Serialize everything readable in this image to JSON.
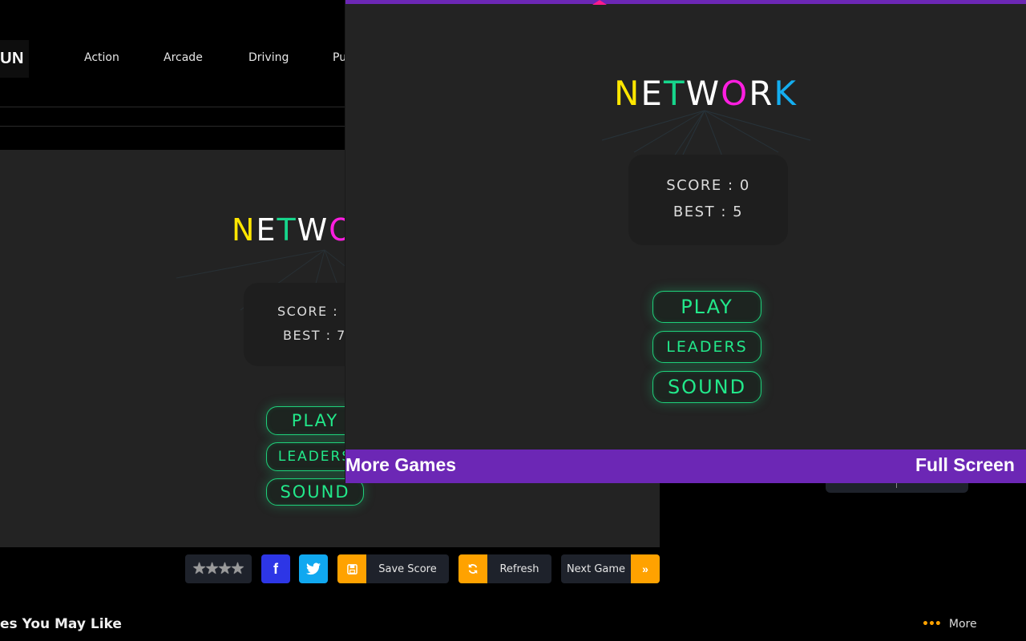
{
  "site": {
    "logo_text": "FUN",
    "nav": [
      "Action",
      "Arcade",
      "Driving",
      "Pu"
    ],
    "section_title": "es You May Like",
    "more_label": "More",
    "more_icon": "ellipsis-icon"
  },
  "background_game": {
    "title_letters": [
      {
        "ch": "N",
        "color": "#ffe600"
      },
      {
        "ch": "E",
        "color": "#ffffff"
      },
      {
        "ch": "T",
        "color": "#17d68c"
      },
      {
        "ch": "W",
        "color": "#ffffff"
      },
      {
        "ch": "O",
        "color": "#ff1ee0"
      }
    ],
    "score_label": "SCORE : ",
    "best_label": "BEST : 7",
    "buttons": [
      "PLAY",
      "LEADERS",
      "SOUND"
    ]
  },
  "action_bar": {
    "rating_stars": 4,
    "rating_icon": "star-icon",
    "facebook_icon": "facebook-icon",
    "facebook_glyph": "f",
    "twitter_icon": "twitter-icon",
    "save_score": {
      "label": "Save Score",
      "icon": "floppy-disk-icon"
    },
    "refresh": {
      "label": "Refresh",
      "icon": "refresh-icon"
    },
    "next_game": {
      "label": "Next Game",
      "icon": "double-chevron-right-icon"
    }
  },
  "game": {
    "title_letters": [
      {
        "ch": "N",
        "color": "#ffe600"
      },
      {
        "ch": "E",
        "color": "#ffffff"
      },
      {
        "ch": "T",
        "color": "#17d68c"
      },
      {
        "ch": "W",
        "color": "#ffffff"
      },
      {
        "ch": "O",
        "color": "#ff1ee0"
      },
      {
        "ch": "R",
        "color": "#ffffff"
      },
      {
        "ch": "K",
        "color": "#14aef0"
      }
    ],
    "score_label": "SCORE",
    "score_value": "0",
    "best_label": "BEST",
    "best_value": "5",
    "buttons": {
      "play": "PLAY",
      "leaders": "LEADERS",
      "sound": "SOUND"
    },
    "bottom_bar": {
      "more_games": "More Games",
      "full_screen": "Full Screen"
    },
    "colors": {
      "bar": "#6c27b5",
      "accent_green": "#22e88a",
      "background": "#232323"
    }
  }
}
